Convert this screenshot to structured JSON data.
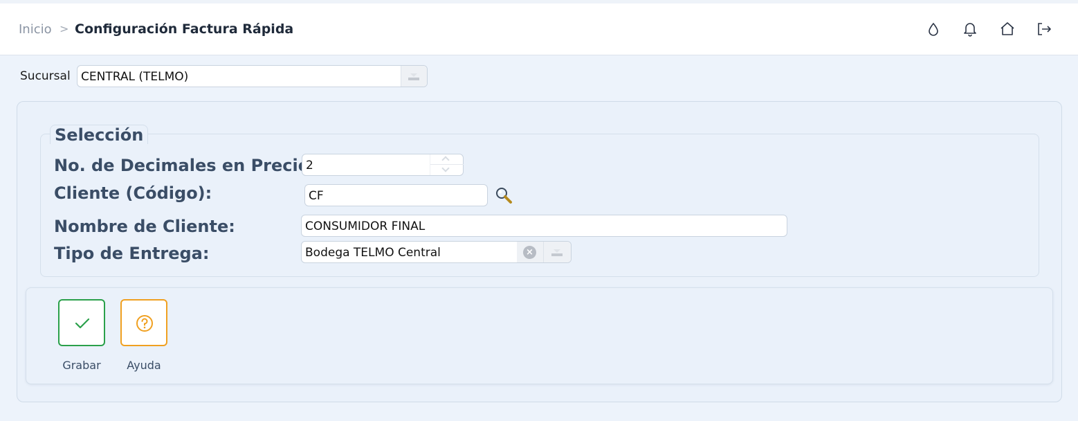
{
  "header": {
    "breadcrumb_home": "Inicio",
    "breadcrumb_separator": ">",
    "page_title": "Configuración Factura Rápida",
    "icons": [
      "theme-drop-icon",
      "bell-icon",
      "home-icon",
      "logout-icon"
    ]
  },
  "sucursal": {
    "label": "Sucursal",
    "value": "CENTRAL (TELMO)"
  },
  "seleccion": {
    "legend": "Selección",
    "decimales_label": "No. de Decimales en Precio:",
    "decimales_value": "2",
    "cliente_codigo_label": "Cliente (Código):",
    "cliente_codigo_value": "CF",
    "nombre_cliente_label": "Nombre de Cliente:",
    "nombre_cliente_value": "CONSUMIDOR FINAL",
    "tipo_entrega_label": "Tipo de Entrega:",
    "tipo_entrega_value": "Bodega TELMO Central"
  },
  "actions": {
    "grabar_label": "Grabar",
    "ayuda_label": "Ayuda",
    "grabar_color": "#2aa04a",
    "ayuda_color": "#f0a020"
  }
}
